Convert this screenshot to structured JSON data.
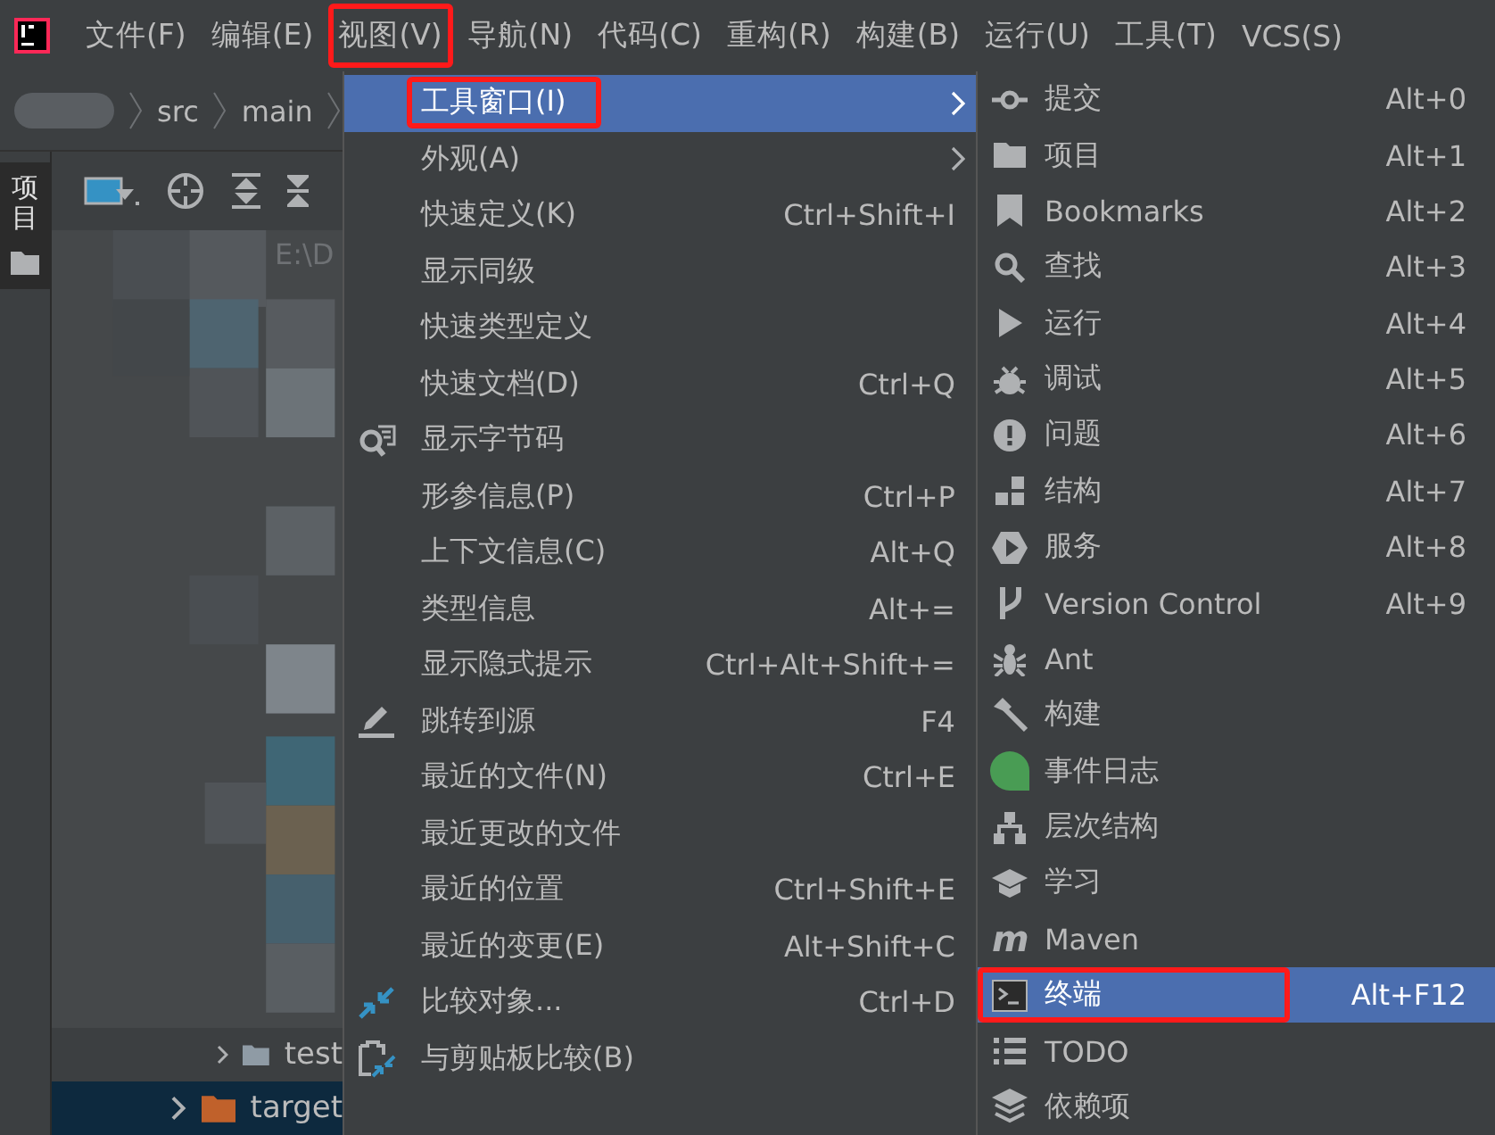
{
  "menubar": [
    {
      "label": "文件(F)",
      "marked": false
    },
    {
      "label": "编辑(E)",
      "marked": false
    },
    {
      "label": "视图(V)",
      "marked": true
    },
    {
      "label": "导航(N)",
      "marked": false
    },
    {
      "label": "代码(C)",
      "marked": false
    },
    {
      "label": "重构(R)",
      "marked": false
    },
    {
      "label": "构建(B)",
      "marked": false
    },
    {
      "label": "运行(U)",
      "marked": false
    },
    {
      "label": "工具(T)",
      "marked": false
    },
    {
      "label": "VCS(S)",
      "marked": false
    }
  ],
  "breadcrumb": [
    "src",
    "main"
  ],
  "side_tab": {
    "label": "项目",
    "selected": true
  },
  "project_path": "E:\\D",
  "tree": [
    {
      "label": "test",
      "selected": false,
      "color": "#8f9ba5"
    },
    {
      "label": "target",
      "selected": true,
      "color": "#c0612b"
    }
  ],
  "view_menu": {
    "groups": [
      [
        {
          "label": "工具窗口(I)",
          "submenu": true,
          "selected": true,
          "marked": true
        },
        {
          "label": "外观(A)",
          "submenu": true,
          "selected": false,
          "marked": false
        }
      ],
      [
        {
          "label": "快速定义(K)",
          "shortcut": "Ctrl+Shift+I",
          "submenu": false,
          "selected": false,
          "marked": false
        },
        {
          "label": "显示同级",
          "submenu": false,
          "selected": false,
          "marked": false
        },
        {
          "label": "快速类型定义",
          "submenu": false,
          "selected": false,
          "marked": false
        },
        {
          "label": "快速文档(D)",
          "shortcut": "Ctrl+Q",
          "submenu": false,
          "selected": false,
          "marked": false
        },
        {
          "label": "显示字节码",
          "submenu": false,
          "selected": false,
          "marked": false
        },
        {
          "label": "形参信息(P)",
          "shortcut": "Ctrl+P",
          "submenu": false,
          "selected": false,
          "marked": false
        },
        {
          "label": "上下文信息(C)",
          "shortcut": "Alt+Q",
          "submenu": false,
          "selected": false,
          "marked": false
        },
        {
          "label": "类型信息",
          "shortcut": "Alt+=",
          "submenu": false,
          "selected": false,
          "marked": false
        },
        {
          "label": "显示隐式提示",
          "shortcut": "Ctrl+Alt+Shift+=",
          "submenu": false,
          "selected": false,
          "marked": false
        }
      ],
      [
        {
          "label": "跳转到源",
          "shortcut": "F4",
          "submenu": false,
          "selected": false,
          "marked": false
        }
      ],
      [
        {
          "label": "最近的文件(N)",
          "shortcut": "Ctrl+E",
          "submenu": false,
          "selected": false,
          "marked": false
        },
        {
          "label": "最近更改的文件",
          "submenu": false,
          "selected": false,
          "marked": false
        },
        {
          "label": "最近的位置",
          "shortcut": "Ctrl+Shift+E",
          "submenu": false,
          "selected": false,
          "marked": false
        },
        {
          "label": "最近的变更(E)",
          "shortcut": "Alt+Shift+C",
          "submenu": false,
          "selected": false,
          "marked": false
        }
      ],
      [
        {
          "label": "比较对象...",
          "shortcut": "Ctrl+D",
          "submenu": false,
          "selected": false,
          "marked": false
        },
        {
          "label": "与剪贴板比较(B)",
          "submenu": false,
          "selected": false,
          "marked": false
        }
      ]
    ]
  },
  "tool_windows_menu": [
    {
      "label": "提交",
      "shortcut": "Alt+0",
      "selected": false,
      "marked": false
    },
    {
      "label": "项目",
      "shortcut": "Alt+1",
      "selected": false,
      "marked": false
    },
    {
      "label": "Bookmarks",
      "shortcut": "Alt+2",
      "selected": false,
      "marked": false
    },
    {
      "label": "查找",
      "shortcut": "Alt+3",
      "selected": false,
      "marked": false
    },
    {
      "label": "运行",
      "shortcut": "Alt+4",
      "selected": false,
      "marked": false
    },
    {
      "label": "调试",
      "shortcut": "Alt+5",
      "selected": false,
      "marked": false
    },
    {
      "label": "问题",
      "shortcut": "Alt+6",
      "selected": false,
      "marked": false
    },
    {
      "label": "结构",
      "shortcut": "Alt+7",
      "selected": false,
      "marked": false
    },
    {
      "label": "服务",
      "shortcut": "Alt+8",
      "selected": false,
      "marked": false
    },
    {
      "label": "Version Control",
      "shortcut": "Alt+9",
      "selected": false,
      "marked": false
    },
    {
      "label": "Ant",
      "selected": false,
      "marked": false
    },
    {
      "label": "构建",
      "selected": false,
      "marked": false
    },
    {
      "label": "事件日志",
      "selected": false,
      "marked": false
    },
    {
      "label": "层次结构",
      "selected": false,
      "marked": false
    },
    {
      "label": "学习",
      "selected": false,
      "marked": false
    },
    {
      "label": "Maven",
      "selected": false,
      "marked": false,
      "glyph": "m"
    },
    {
      "label": "终端",
      "shortcut": "Alt+F12",
      "selected": true,
      "marked": true
    },
    {
      "label": "TODO",
      "selected": false,
      "marked": false
    },
    {
      "label": "依赖项",
      "selected": false,
      "marked": false
    }
  ]
}
